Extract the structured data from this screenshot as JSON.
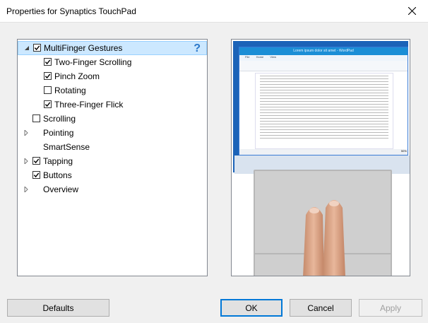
{
  "window": {
    "title": "Properties for Synaptics TouchPad"
  },
  "tree": {
    "items": [
      {
        "label": "MultiFinger Gestures",
        "expanded": true,
        "checked": true,
        "selected": true
      },
      {
        "label": "Two-Finger Scrolling",
        "checked": true
      },
      {
        "label": "Pinch Zoom",
        "checked": true
      },
      {
        "label": "Rotating",
        "checked": false
      },
      {
        "label": "Three-Finger Flick",
        "checked": true
      },
      {
        "label": "Scrolling",
        "checked": false
      },
      {
        "label": "Pointing"
      },
      {
        "label": "SmartSense"
      },
      {
        "label": "Tapping",
        "checked": true
      },
      {
        "label": "Buttons",
        "checked": true
      },
      {
        "label": "Overview"
      }
    ],
    "help": "?"
  },
  "preview": {
    "app_title": "Lorem ipsum dolor sit amet - WordPad",
    "menu": [
      "File",
      "Home",
      "View"
    ],
    "zoom": "50%"
  },
  "buttons": {
    "defaults": "Defaults",
    "ok": "OK",
    "cancel": "Cancel",
    "apply": "Apply"
  },
  "colors": {
    "selection": "#cce8ff",
    "accent": "#0078d7",
    "help": "#2a77c9"
  }
}
